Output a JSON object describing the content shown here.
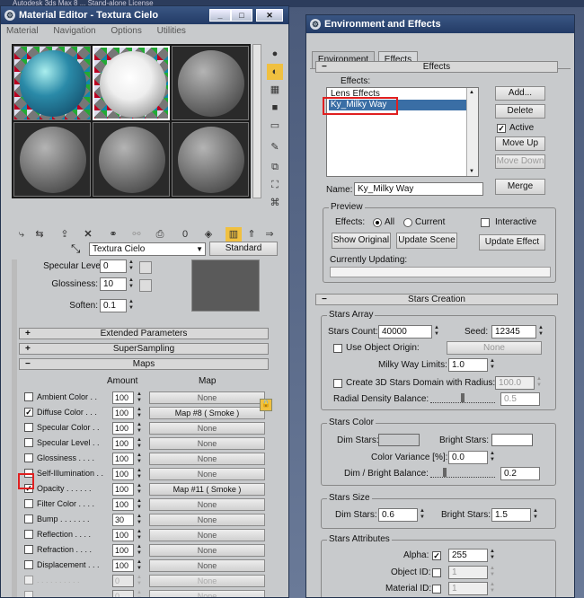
{
  "background": {
    "title_fragment": "Autodesk 3ds Max 8 ... Stand-alone License"
  },
  "material_editor": {
    "title": "Material Editor - Textura Cielo",
    "menu": [
      "Material",
      "Navigation",
      "Options",
      "Utilities"
    ],
    "window_buttons": [
      "_",
      "□",
      "✕"
    ],
    "material_name": "Textura Cielo",
    "material_type": "Standard",
    "params": {
      "specular_level_label": "Specular Level:",
      "specular_level_value": "0",
      "glossiness_label": "Glossiness:",
      "glossiness_value": "10",
      "soften_label": "Soften:",
      "soften_value": "0.1"
    },
    "rollouts": {
      "extended": "Extended Parameters",
      "supersampling": "SuperSampling",
      "maps": "Maps"
    },
    "maps_header": {
      "amount": "Amount",
      "map": "Map"
    },
    "maps": [
      {
        "label": "Ambient Color . .",
        "checked": false,
        "amount": "100",
        "map": "None",
        "disabled": false
      },
      {
        "label": "Diffuse Color . . .",
        "checked": true,
        "amount": "100",
        "map": "Map #8  ( Smoke )",
        "disabled": false
      },
      {
        "label": "Specular Color  . .",
        "checked": false,
        "amount": "100",
        "map": "None",
        "disabled": false
      },
      {
        "label": "Specular Level  . .",
        "checked": false,
        "amount": "100",
        "map": "None",
        "disabled": false
      },
      {
        "label": "Glossiness  . . . .",
        "checked": false,
        "amount": "100",
        "map": "None",
        "disabled": false
      },
      {
        "label": "Self-Illumination . .",
        "checked": false,
        "amount": "100",
        "map": "None",
        "disabled": false
      },
      {
        "label": "Opacity  . . . . . .",
        "checked": true,
        "amount": "100",
        "map": "Map #11  ( Smoke )",
        "disabled": false
      },
      {
        "label": "Filter Color . . . .",
        "checked": false,
        "amount": "100",
        "map": "None",
        "disabled": false
      },
      {
        "label": "Bump  . . . . . . .",
        "checked": false,
        "amount": "30",
        "map": "None",
        "disabled": false
      },
      {
        "label": "Reflection  . . . .",
        "checked": false,
        "amount": "100",
        "map": "None",
        "disabled": false
      },
      {
        "label": "Refraction  . . . .",
        "checked": false,
        "amount": "100",
        "map": "None",
        "disabled": false
      },
      {
        "label": "Displacement  . . .",
        "checked": false,
        "amount": "100",
        "map": "None",
        "disabled": false
      },
      {
        "label": ". . . . . . . . . .",
        "checked": false,
        "amount": "0",
        "map": "None",
        "disabled": true
      },
      {
        "label": ". . . . . . . . . .",
        "checked": false,
        "amount": "0",
        "map": "None",
        "disabled": true
      }
    ]
  },
  "env_effects": {
    "title": "Environment and Effects",
    "tabs": [
      "Environment",
      "Effects"
    ],
    "effects_rollout": "Effects",
    "effects_label": "Effects:",
    "effects_list": [
      "Lens Effects",
      "Ky_Milky Way"
    ],
    "buttons": {
      "add": "Add...",
      "delete": "Delete",
      "move_up": "Move Up",
      "move_down": "Move Down",
      "merge": "Merge"
    },
    "active_label": "Active",
    "active_checked": true,
    "name_label": "Name:",
    "name_value": "Ky_Milky Way",
    "preview": {
      "group": "Preview",
      "effects_label": "Effects:",
      "all": "All",
      "current": "Current",
      "interactive": "Interactive",
      "show_original": "Show Original",
      "update_scene": "Update Scene",
      "update_effect": "Update Effect",
      "currently_updating": "Currently Updating:"
    },
    "stars_rollout": "Stars Creation",
    "stars_array": {
      "group": "Stars Array",
      "count_label": "Stars Count:",
      "count_value": "40000",
      "seed_label": "Seed:",
      "seed_value": "12345",
      "use_object_origin": "Use Object Origin:",
      "none_button": "None",
      "milky_way_limits_label": "Milky Way Limits:",
      "milky_way_limits_value": "1.0",
      "create_3d_label": "Create 3D Stars Domain with Radius:",
      "create_3d_value": "100.0",
      "radial_density_label": "Radial Density Balance:",
      "radial_density_value": "0.5",
      "radial_density_level": 0.5
    },
    "stars_color": {
      "group": "Stars Color",
      "dim_label": "Dim Stars:",
      "bright_label": "Bright Stars:",
      "dim_color": "#c8cacc",
      "bright_color": "#ffffff",
      "variance_label": "Color Variance [%]:",
      "variance_value": "0.0",
      "balance_label": "Dim / Bright Balance:",
      "balance_value": "0.2",
      "balance_level": 0.2
    },
    "stars_size": {
      "group": "Stars Size",
      "dim_label": "Dim Stars:",
      "dim_value": "0.6",
      "bright_label": "Bright Stars:",
      "bright_value": "1.5"
    },
    "stars_attributes": {
      "group": "Stars Attributes",
      "alpha_label": "Alpha:",
      "alpha_checked": true,
      "alpha_value": "255",
      "object_id_label": "Object ID:",
      "object_id_value": "1",
      "material_id_label": "Material ID:",
      "material_id_value": "1"
    }
  },
  "colors": {
    "highlight": "#e02020",
    "title_bar": "#233b66",
    "selection": "#3a6ea5"
  }
}
